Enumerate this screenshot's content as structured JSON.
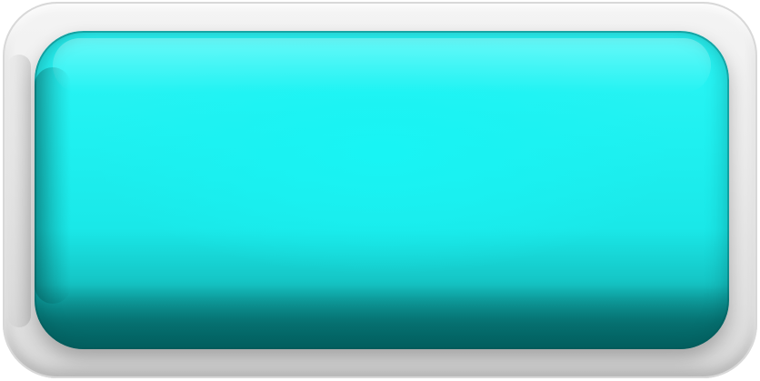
{
  "button": {
    "label": "",
    "face_color": "#1ff0f0",
    "frame_color": "#ededed"
  }
}
